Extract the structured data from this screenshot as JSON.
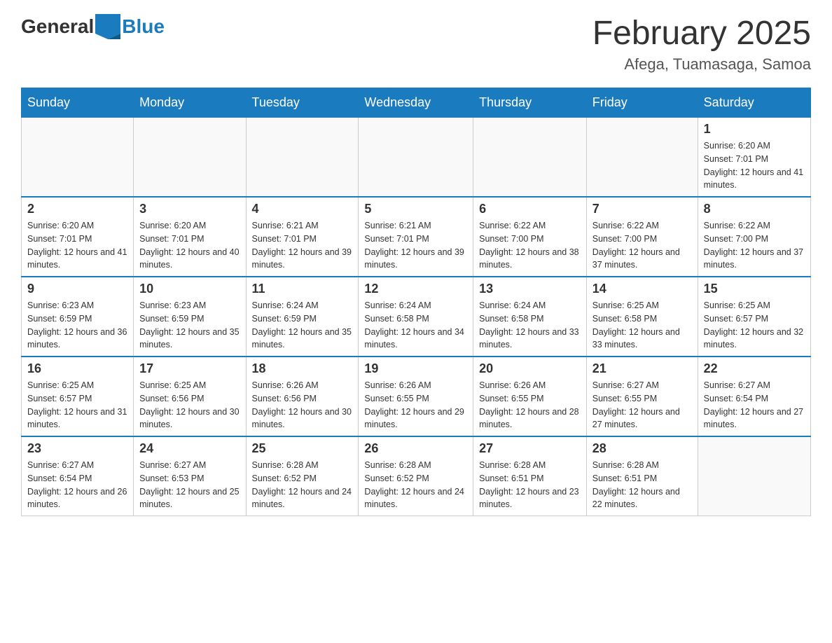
{
  "header": {
    "logo_general": "General",
    "logo_blue": "Blue",
    "month": "February 2025",
    "location": "Afega, Tuamasaga, Samoa"
  },
  "days_of_week": [
    "Sunday",
    "Monday",
    "Tuesday",
    "Wednesday",
    "Thursday",
    "Friday",
    "Saturday"
  ],
  "weeks": [
    [
      {
        "day": "",
        "info": ""
      },
      {
        "day": "",
        "info": ""
      },
      {
        "day": "",
        "info": ""
      },
      {
        "day": "",
        "info": ""
      },
      {
        "day": "",
        "info": ""
      },
      {
        "day": "",
        "info": ""
      },
      {
        "day": "1",
        "info": "Sunrise: 6:20 AM\nSunset: 7:01 PM\nDaylight: 12 hours and 41 minutes."
      }
    ],
    [
      {
        "day": "2",
        "info": "Sunrise: 6:20 AM\nSunset: 7:01 PM\nDaylight: 12 hours and 41 minutes."
      },
      {
        "day": "3",
        "info": "Sunrise: 6:20 AM\nSunset: 7:01 PM\nDaylight: 12 hours and 40 minutes."
      },
      {
        "day": "4",
        "info": "Sunrise: 6:21 AM\nSunset: 7:01 PM\nDaylight: 12 hours and 39 minutes."
      },
      {
        "day": "5",
        "info": "Sunrise: 6:21 AM\nSunset: 7:01 PM\nDaylight: 12 hours and 39 minutes."
      },
      {
        "day": "6",
        "info": "Sunrise: 6:22 AM\nSunset: 7:00 PM\nDaylight: 12 hours and 38 minutes."
      },
      {
        "day": "7",
        "info": "Sunrise: 6:22 AM\nSunset: 7:00 PM\nDaylight: 12 hours and 37 minutes."
      },
      {
        "day": "8",
        "info": "Sunrise: 6:22 AM\nSunset: 7:00 PM\nDaylight: 12 hours and 37 minutes."
      }
    ],
    [
      {
        "day": "9",
        "info": "Sunrise: 6:23 AM\nSunset: 6:59 PM\nDaylight: 12 hours and 36 minutes."
      },
      {
        "day": "10",
        "info": "Sunrise: 6:23 AM\nSunset: 6:59 PM\nDaylight: 12 hours and 35 minutes."
      },
      {
        "day": "11",
        "info": "Sunrise: 6:24 AM\nSunset: 6:59 PM\nDaylight: 12 hours and 35 minutes."
      },
      {
        "day": "12",
        "info": "Sunrise: 6:24 AM\nSunset: 6:58 PM\nDaylight: 12 hours and 34 minutes."
      },
      {
        "day": "13",
        "info": "Sunrise: 6:24 AM\nSunset: 6:58 PM\nDaylight: 12 hours and 33 minutes."
      },
      {
        "day": "14",
        "info": "Sunrise: 6:25 AM\nSunset: 6:58 PM\nDaylight: 12 hours and 33 minutes."
      },
      {
        "day": "15",
        "info": "Sunrise: 6:25 AM\nSunset: 6:57 PM\nDaylight: 12 hours and 32 minutes."
      }
    ],
    [
      {
        "day": "16",
        "info": "Sunrise: 6:25 AM\nSunset: 6:57 PM\nDaylight: 12 hours and 31 minutes."
      },
      {
        "day": "17",
        "info": "Sunrise: 6:25 AM\nSunset: 6:56 PM\nDaylight: 12 hours and 30 minutes."
      },
      {
        "day": "18",
        "info": "Sunrise: 6:26 AM\nSunset: 6:56 PM\nDaylight: 12 hours and 30 minutes."
      },
      {
        "day": "19",
        "info": "Sunrise: 6:26 AM\nSunset: 6:55 PM\nDaylight: 12 hours and 29 minutes."
      },
      {
        "day": "20",
        "info": "Sunrise: 6:26 AM\nSunset: 6:55 PM\nDaylight: 12 hours and 28 minutes."
      },
      {
        "day": "21",
        "info": "Sunrise: 6:27 AM\nSunset: 6:55 PM\nDaylight: 12 hours and 27 minutes."
      },
      {
        "day": "22",
        "info": "Sunrise: 6:27 AM\nSunset: 6:54 PM\nDaylight: 12 hours and 27 minutes."
      }
    ],
    [
      {
        "day": "23",
        "info": "Sunrise: 6:27 AM\nSunset: 6:54 PM\nDaylight: 12 hours and 26 minutes."
      },
      {
        "day": "24",
        "info": "Sunrise: 6:27 AM\nSunset: 6:53 PM\nDaylight: 12 hours and 25 minutes."
      },
      {
        "day": "25",
        "info": "Sunrise: 6:28 AM\nSunset: 6:52 PM\nDaylight: 12 hours and 24 minutes."
      },
      {
        "day": "26",
        "info": "Sunrise: 6:28 AM\nSunset: 6:52 PM\nDaylight: 12 hours and 24 minutes."
      },
      {
        "day": "27",
        "info": "Sunrise: 6:28 AM\nSunset: 6:51 PM\nDaylight: 12 hours and 23 minutes."
      },
      {
        "day": "28",
        "info": "Sunrise: 6:28 AM\nSunset: 6:51 PM\nDaylight: 12 hours and 22 minutes."
      },
      {
        "day": "",
        "info": ""
      }
    ]
  ]
}
